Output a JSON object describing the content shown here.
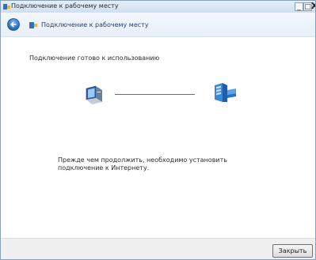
{
  "window": {
    "title": "Подключение к рабочему месту",
    "controls": {
      "minimize": "_",
      "maximize": "□",
      "close": "X"
    }
  },
  "nav": {
    "title": "Подключение к рабочему месту",
    "back_icon": "back-arrow-icon",
    "page_icon": "network-connection-icon"
  },
  "content": {
    "status": "Подключение готово к использованию",
    "client_icon": "computer-icon",
    "server_icon": "workplace-server-icon",
    "message": "Прежде чем продолжить, необходимо установить подключение к Интернету."
  },
  "footer": {
    "close_label": "Закрыть"
  },
  "colors": {
    "titlebar": "#cfdff0",
    "nav_text": "#1e3e76",
    "accent": "#2b6cc4"
  }
}
